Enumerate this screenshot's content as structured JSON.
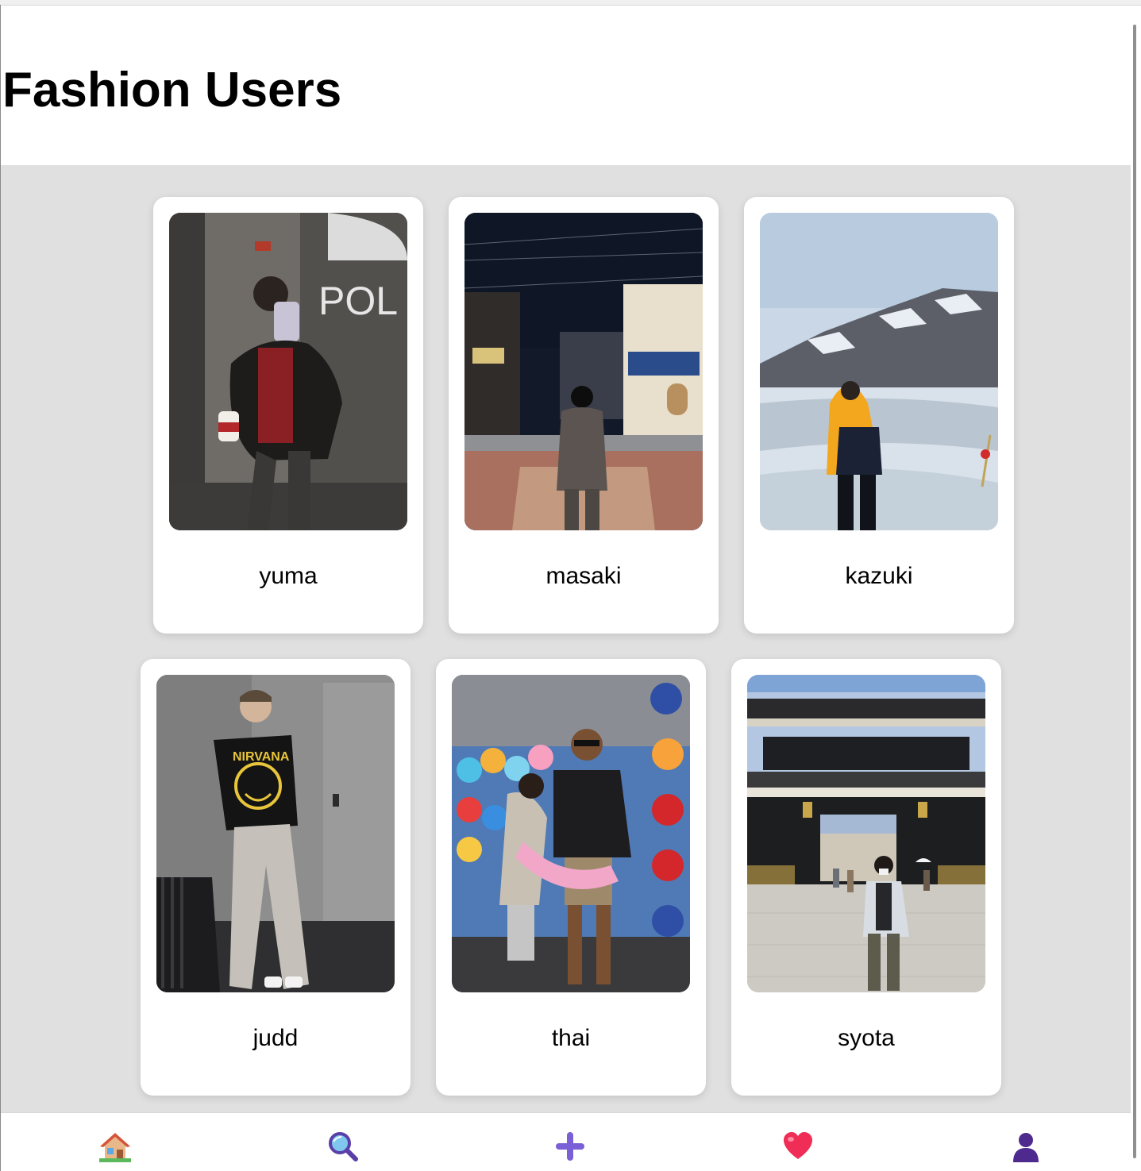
{
  "header": {
    "title": "Fashion Users"
  },
  "users": [
    {
      "name": "yuma"
    },
    {
      "name": "masaki"
    },
    {
      "name": "kazuki"
    },
    {
      "name": "judd"
    },
    {
      "name": "thai"
    },
    {
      "name": "syota"
    }
  ],
  "photo_text": {
    "yuma_wall_sign": "POL"
  },
  "bottom_nav": {
    "items": [
      {
        "icon": "home-icon"
      },
      {
        "icon": "search-icon"
      },
      {
        "icon": "plus-icon"
      },
      {
        "icon": "heart-icon"
      },
      {
        "icon": "profile-icon"
      }
    ]
  },
  "colors": {
    "page_background": "#e0e0e0",
    "card_background": "#ffffff",
    "plus_accent": "#7a5fd6",
    "heart_accent": "#ef2d56",
    "profile_accent": "#4e2a8e"
  }
}
